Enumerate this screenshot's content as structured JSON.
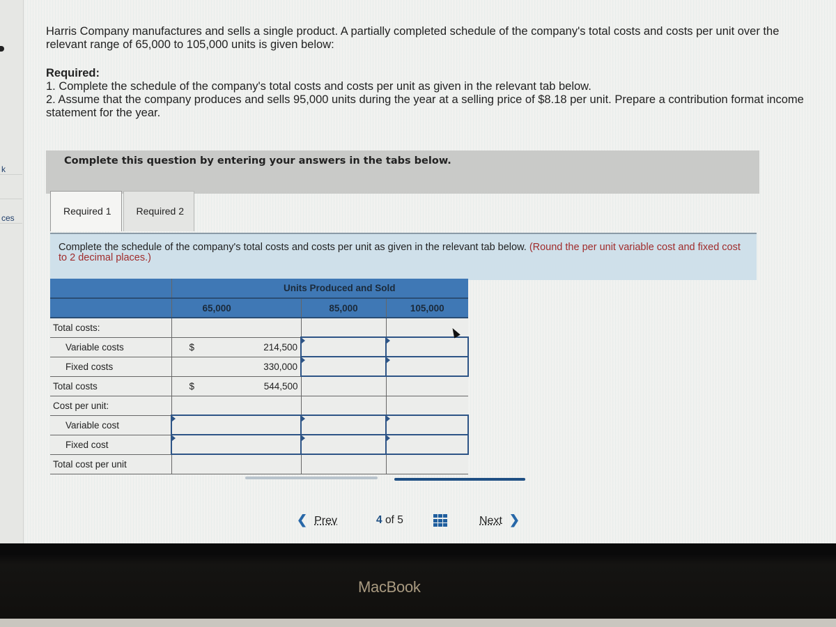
{
  "sidebar": {
    "partial_items": [
      "k",
      "",
      "ces"
    ]
  },
  "intro": {
    "text": "Harris Company manufactures and sells a single product. A partially completed schedule of the company's total costs and costs per unit over the relevant range of 65,000 to 105,000 units is given below:"
  },
  "required": {
    "title": "Required:",
    "items": [
      "1. Complete the schedule of the company's total costs and costs per unit as given in the relevant tab below.",
      "2. Assume that the company produces and sells 95,000 units during the year at a selling price of $8.18 per unit. Prepare a contribution format income statement for the year."
    ]
  },
  "banner": {
    "text": "Complete this question by entering your answers in the tabs below."
  },
  "tabs": [
    {
      "label": "Required 1",
      "active": true
    },
    {
      "label": "Required 2",
      "active": false
    }
  ],
  "instruction": {
    "text": "Complete the schedule of the company's total costs and costs per unit as given in the relevant tab below.",
    "note": "(Round the per unit variable cost and fixed cost to 2 decimal places.)"
  },
  "schedule": {
    "group_header": "Units Produced and Sold",
    "columns": [
      "65,000",
      "85,000",
      "105,000"
    ],
    "rows": [
      {
        "label": "Total costs:",
        "dollar": "",
        "values": [
          "",
          "",
          ""
        ]
      },
      {
        "label": "Variable costs",
        "dollar": "$",
        "values": [
          "214,500",
          "",
          ""
        ]
      },
      {
        "label": "Fixed costs",
        "dollar": "",
        "values": [
          "330,000",
          "",
          ""
        ]
      },
      {
        "label": "Total costs",
        "dollar": "$",
        "values": [
          "544,500",
          "",
          ""
        ]
      },
      {
        "label": "Cost per unit:",
        "dollar": "",
        "values": [
          "",
          "",
          ""
        ]
      },
      {
        "label": "Variable cost",
        "dollar": "",
        "values": [
          "",
          "",
          ""
        ]
      },
      {
        "label": "Fixed cost",
        "dollar": "",
        "values": [
          "",
          "",
          ""
        ]
      },
      {
        "label": "Total cost per unit",
        "dollar": "",
        "values": [
          "",
          "",
          ""
        ]
      }
    ]
  },
  "pager": {
    "prev_label": "Prev",
    "current": "4",
    "of_label": "of",
    "total": "5",
    "next_label": "Next"
  },
  "device": {
    "brand": "MacBook"
  }
}
